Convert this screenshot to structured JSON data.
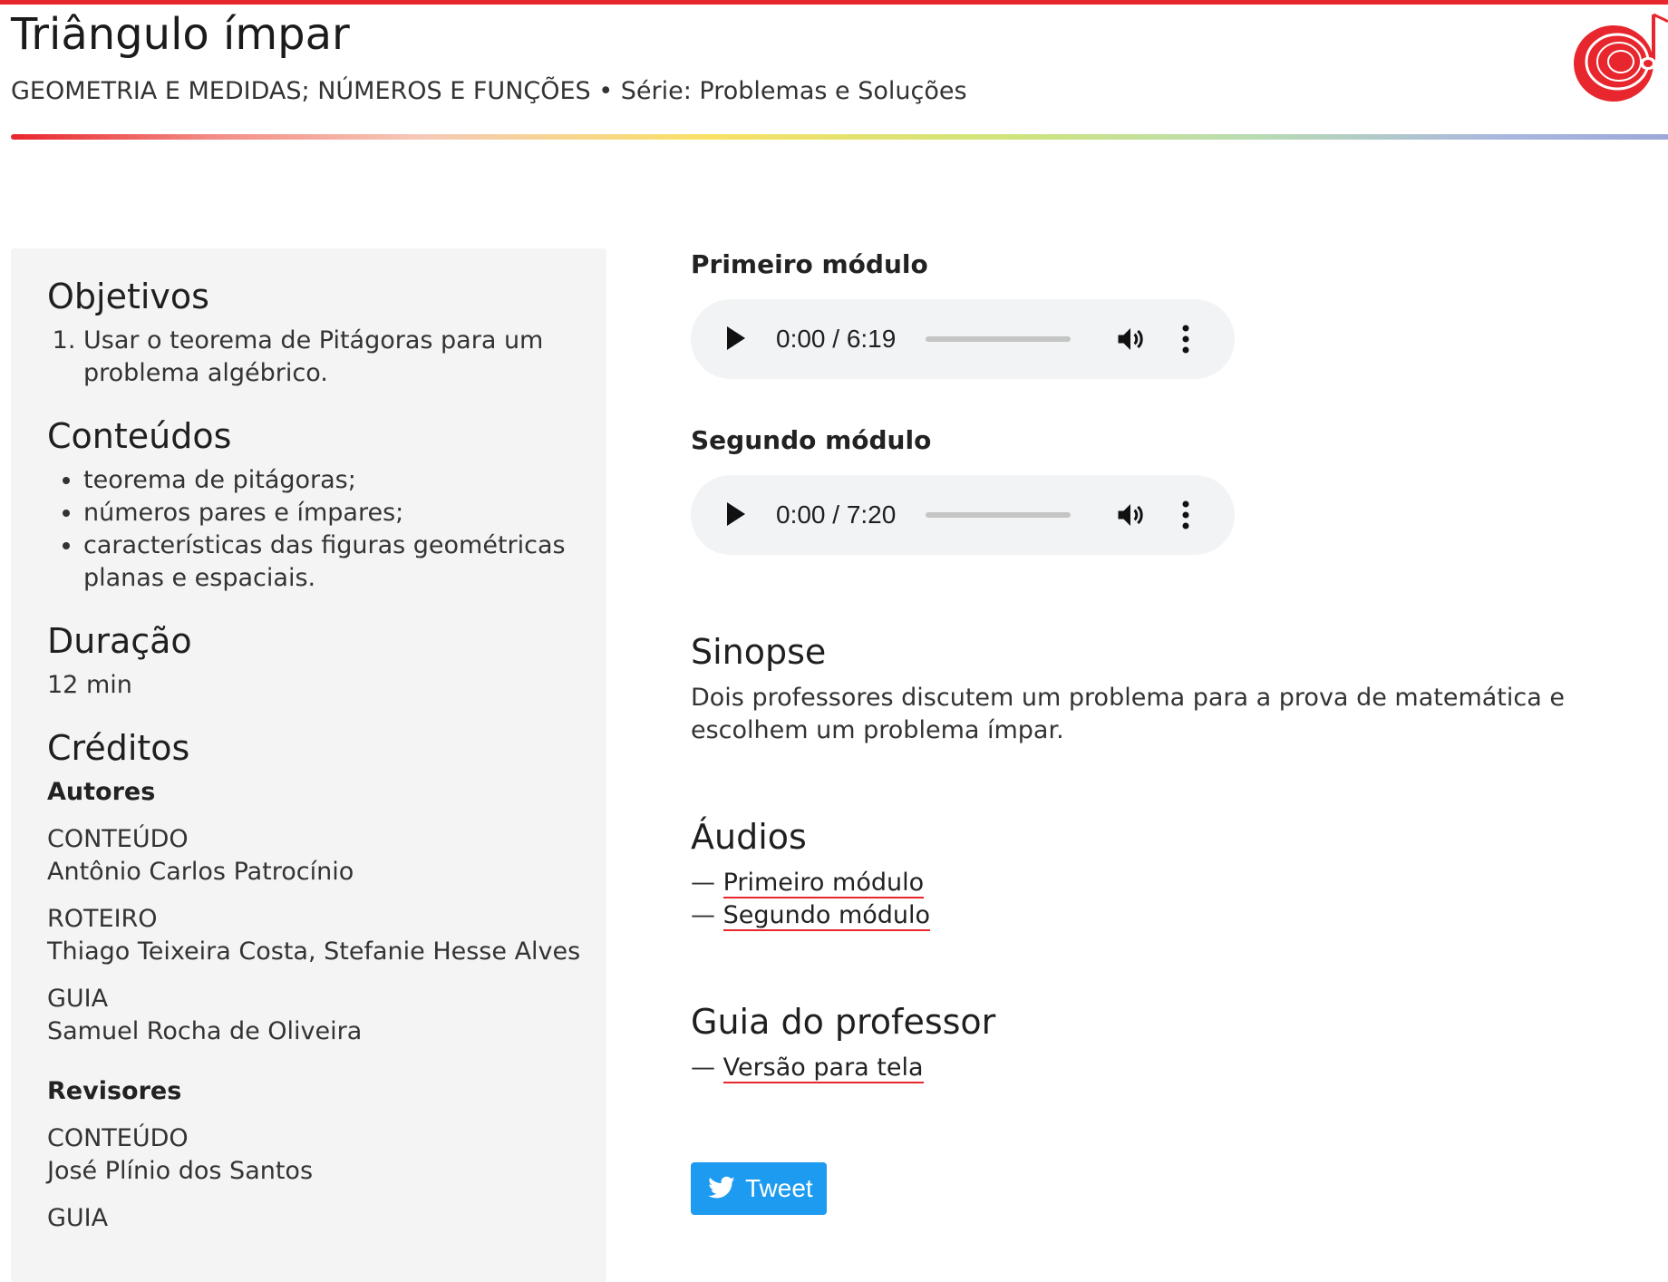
{
  "header": {
    "title": "Triângulo ímpar",
    "subtitle": "GEOMETRIA E MEDIDAS; NÚMEROS E FUNÇÕES • Série: Problemas e Soluções"
  },
  "sidebar": {
    "objetivos": {
      "title": "Objetivos",
      "items": [
        "Usar o teorema de Pitágoras para um problema algébrico."
      ]
    },
    "conteudos": {
      "title": "Conteúdos",
      "items": [
        "teorema de pitágoras;",
        "números pares e ímpares;",
        "características das figuras geométricas planas e espaciais."
      ]
    },
    "duracao": {
      "title": "Duração",
      "value": "12 min"
    },
    "creditos": {
      "title": "Créditos",
      "autores": {
        "heading": "Autores",
        "entries": [
          {
            "role": "CONTEÚDO",
            "name": "Antônio Carlos Patrocínio"
          },
          {
            "role": "ROTEIRO",
            "name": "Thiago Teixeira Costa, Stefanie Hesse Alves"
          },
          {
            "role": "GUIA",
            "name": "Samuel Rocha de Oliveira"
          }
        ]
      },
      "revisores": {
        "heading": "Revisores",
        "entries": [
          {
            "role": "CONTEÚDO",
            "name": "José Plínio dos Santos"
          },
          {
            "role": "GUIA",
            "name": ""
          }
        ]
      }
    }
  },
  "main": {
    "players": [
      {
        "label": "Primeiro módulo",
        "time": "0:00 / 6:19"
      },
      {
        "label": "Segundo módulo",
        "time": "0:00 / 7:20"
      }
    ],
    "sinopse": {
      "title": "Sinopse",
      "text": "Dois professores discutem um problema para a prova de matemática e escolhem um problema ímpar."
    },
    "audios": {
      "title": "Áudios",
      "dash": "—",
      "links": [
        "Primeiro módulo",
        "Segundo módulo"
      ]
    },
    "guia": {
      "title": "Guia do professor",
      "dash": "—",
      "links": [
        "Versão para tela"
      ]
    },
    "tweet_label": "Tweet"
  },
  "colors": {
    "accent": "#e8262d",
    "player_bg": "#f1f3f4",
    "sidebar_bg": "#f4f4f4",
    "tweet": "#1d9bf0"
  }
}
